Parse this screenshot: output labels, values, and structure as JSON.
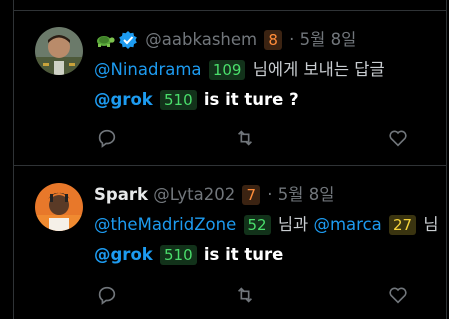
{
  "tweets": [
    {
      "handle": "@aabkashem",
      "handle_badge": "8",
      "separator": "·",
      "date": "5월 8일",
      "reply_to": "@Ninadrama",
      "reply_to_badge": "109",
      "reply_suffix": "님에게 보내는 답글",
      "mention": "@grok",
      "mention_badge": "510",
      "text": "is it ture ?"
    },
    {
      "name": "Spark",
      "handle": "@Lyta202",
      "handle_badge": "7",
      "separator": "·",
      "date": "5월 8일",
      "reply_to": "@theMadridZone",
      "reply_to_badge": "52",
      "reply_mid": "님과",
      "reply_to2": "@marca",
      "reply_to2_badge": "27",
      "reply_suffix": "님",
      "mention": "@grok",
      "mention_badge": "510",
      "text": "is it ture"
    }
  ],
  "icons": [
    "reply-icon",
    "retweet-icon",
    "like-icon",
    "verified-icon",
    "turtle-emoji-icon"
  ],
  "colors": {
    "accent": "#1d9bf0",
    "muted": "#71767b",
    "background": "#000000"
  }
}
